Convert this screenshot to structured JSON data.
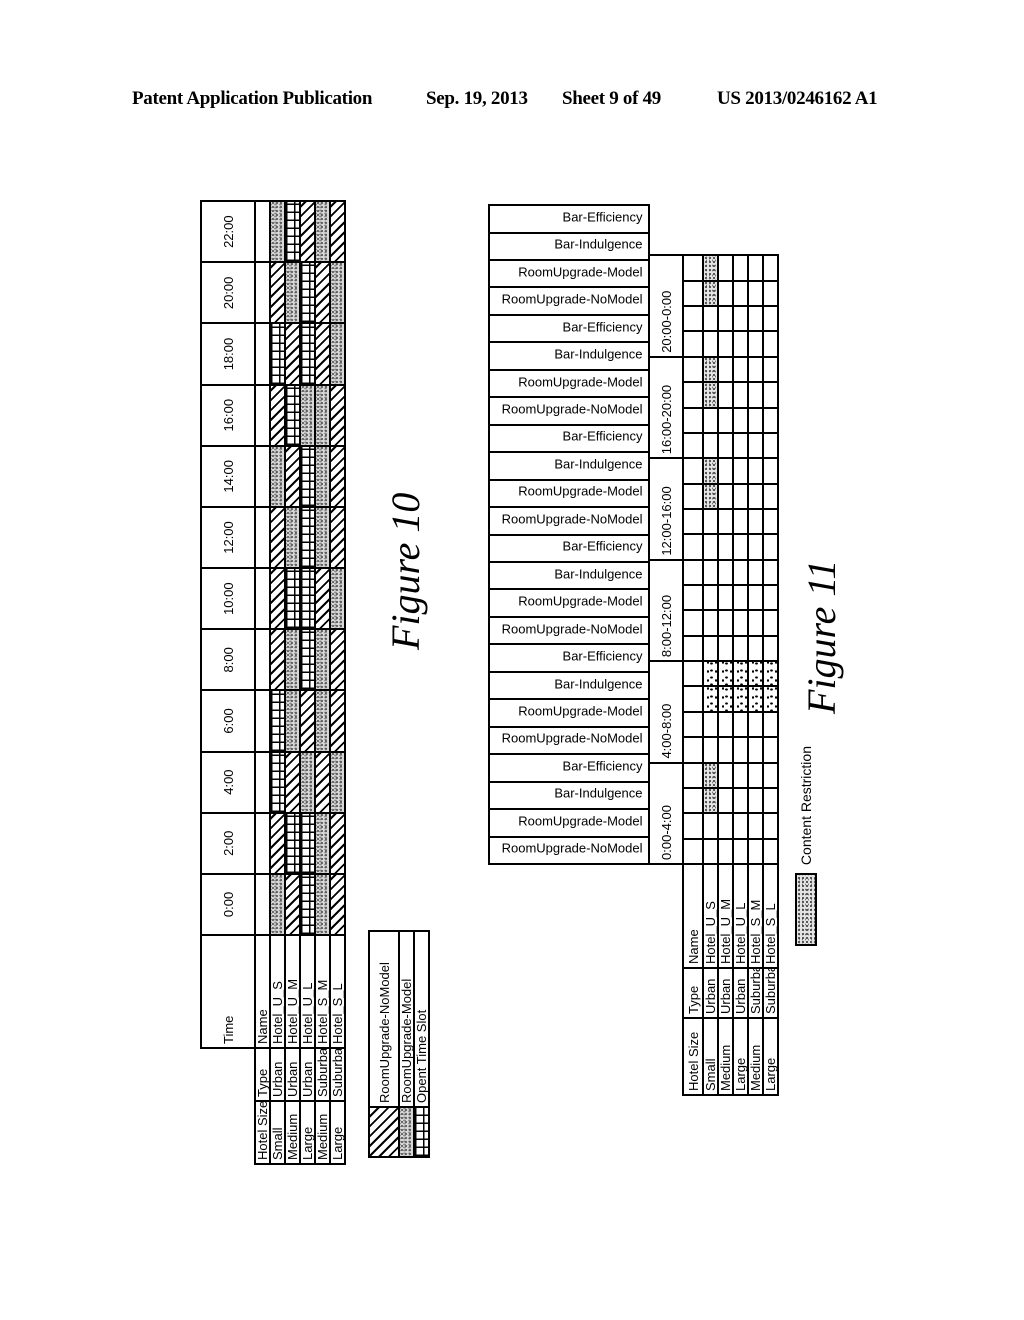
{
  "header": {
    "publication": "Patent Application Publication",
    "date": "Sep. 19, 2013",
    "sheet": "Sheet 9 of 49",
    "number": "US 2013/0246162 A1"
  },
  "figure10": {
    "caption": "Figure 10",
    "columns": {
      "hotel_size": "Hotel Size",
      "type": "Type",
      "time": "Time",
      "name": "Name"
    },
    "times": [
      "0:00",
      "2:00",
      "4:00",
      "6:00",
      "8:00",
      "10:00",
      "12:00",
      "14:00",
      "16:00",
      "18:00",
      "20:00",
      "22:00"
    ],
    "hotels": [
      {
        "size": "Small",
        "type": "Urban",
        "name": "Hotel_U_S",
        "slots": [
          "model",
          "noModel",
          "open",
          "open",
          "noModel",
          "noModel",
          "noModel",
          "model",
          "noModel",
          "open",
          "noModel",
          "model"
        ]
      },
      {
        "size": "Medium",
        "type": "Urban",
        "name": "Hotel_U_M",
        "slots": [
          "noModel",
          "open",
          "noModel",
          "model",
          "model",
          "open",
          "model",
          "noModel",
          "open",
          "noModel",
          "model",
          "open"
        ]
      },
      {
        "size": "Large",
        "type": "Urban",
        "name": "Hotel_U_L",
        "slots": [
          "open",
          "open",
          "model",
          "noModel",
          "open",
          "open",
          "open",
          "open",
          "model",
          "open",
          "open",
          "noModel"
        ]
      },
      {
        "size": "Medium",
        "type": "Suburban",
        "name": "Hotel_S_M",
        "slots": [
          "model",
          "model",
          "noModel",
          "model",
          "model",
          "noModel",
          "model",
          "model",
          "model",
          "noModel",
          "noModel",
          "model"
        ]
      },
      {
        "size": "Large",
        "type": "Suburban",
        "name": "Hotel_S_L",
        "slots": [
          "noModel",
          "noModel",
          "model",
          "noModel",
          "noModel",
          "model",
          "noModel",
          "noModel",
          "noModel",
          "model",
          "model",
          "noModel"
        ]
      }
    ],
    "legend": [
      {
        "pattern": "noModel",
        "label": "RoomUpgrade-NoModel"
      },
      {
        "pattern": "model",
        "label": "RoomUpgrade-Model"
      },
      {
        "pattern": "open",
        "label": "Opent Time Slot"
      }
    ]
  },
  "figure11": {
    "caption": "Figure 11",
    "columns": {
      "hotel_size": "Hotel Size",
      "type": "Type",
      "name": "Name"
    },
    "time_slots": [
      {
        "label": "0:00-4:00",
        "contents": [
          "RoomUpgrade-NoModel",
          "RoomUpgrade-Model",
          "Bar-Indulgence",
          "Bar-Efficiency"
        ]
      },
      {
        "label": "4:00-8:00",
        "contents": [
          "RoomUpgrade-NoModel",
          "RoomUpgrade-Model",
          "Bar-Indulgence",
          "Bar-Efficiency"
        ]
      },
      {
        "label": "8:00-12:00",
        "contents": [
          "RoomUpgrade-NoModel",
          "RoomUpgrade-Model",
          "Bar-Indulgence",
          "Bar-Efficiency"
        ]
      },
      {
        "label": "12:00-16:00",
        "contents": [
          "RoomUpgrade-NoModel",
          "RoomUpgrade-Model",
          "Bar-Indulgence",
          "Bar-Efficiency"
        ]
      },
      {
        "label": "16:00-20:00",
        "contents": [
          "RoomUpgrade-NoModel",
          "RoomUpgrade-Model",
          "Bar-Indulgence",
          "Bar-Efficiency"
        ]
      },
      {
        "label": "20:00-0:00",
        "contents": [
          "RoomUpgrade-NoModel",
          "RoomUpgrade-Model",
          "Bar-Indulgence",
          "Bar-Efficiency"
        ]
      }
    ],
    "hotels": [
      {
        "size": "Small",
        "type": "Urban",
        "name": "Hotel_U_S"
      },
      {
        "size": "Medium",
        "type": "Urban",
        "name": "Hotel_U_M"
      },
      {
        "size": "Large",
        "type": "Urban",
        "name": "Hotel_U_L"
      },
      {
        "size": "Medium",
        "type": "Suburban",
        "name": "Hotel_S_M"
      },
      {
        "size": "Large",
        "type": "Suburban",
        "name": "Hotel_S_L"
      }
    ],
    "restrictions": [
      {
        "slot": 0,
        "contents": [
          2,
          3
        ],
        "hotels": [
          0
        ]
      },
      {
        "slot": 1,
        "contents": [
          2,
          3
        ],
        "hotels": [
          0,
          1,
          2,
          3,
          4
        ]
      },
      {
        "slot": 3,
        "contents": [
          2,
          3
        ],
        "hotels": [
          0
        ]
      },
      {
        "slot": 4,
        "contents": [
          2,
          3
        ],
        "hotels": [
          0
        ]
      },
      {
        "slot": 5,
        "contents": [
          2,
          3
        ],
        "hotels": [
          0
        ]
      }
    ],
    "legend": {
      "label": "Content Restriction"
    }
  }
}
